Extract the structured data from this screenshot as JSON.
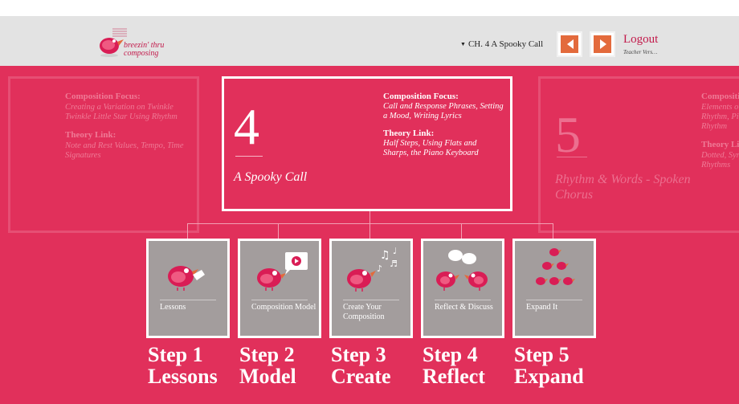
{
  "header": {
    "logo_line1": "breezin' thru",
    "logo_line2": "composing",
    "chapter_select": "CH. 4 A Spooky Call",
    "logout": "Logout",
    "teacher": "Teacher Vers…"
  },
  "colors": {
    "accent": "#e1305b",
    "header_bg": "#e3e3e3",
    "nav_orange": "#e36a3c",
    "step_gray": "#a39d9d"
  },
  "prev_chapter": {
    "focus_heading": "Composition Focus:",
    "focus_text": "Creating a Variation on Twinkle Twinkle Little Star Using Rhythm",
    "theory_heading": "Theory Link:",
    "theory_text": "Note and Rest Values, Tempo, Time Signatures"
  },
  "current_chapter": {
    "number": "4",
    "title": "A Spooky Call",
    "focus_heading": "Composition Focus:",
    "focus_text": "Call and Response Phrases, Setting a Mood, Writing Lyrics",
    "theory_heading": "Theory Link:",
    "theory_text": "Half Steps, Using Flats and Sharps, the Piano Keyboard"
  },
  "next_chapter": {
    "number": "5",
    "title": "Rhythm & Words - Spoken Chorus",
    "focus_heading": "Compositi",
    "focus_text": "Elements o Rhythm, Pi Rhythm",
    "theory_heading": "Theory Li",
    "theory_text": "Dotted, Syr Rhythms"
  },
  "steps": [
    {
      "label": "Lessons",
      "step": "Step 1",
      "name": "Lessons"
    },
    {
      "label": "Composition Model",
      "step": "Step 2",
      "name": "Model"
    },
    {
      "label": "Create Your Composition",
      "step": "Step 3",
      "name": "Create"
    },
    {
      "label": "Reflect & Discuss",
      "step": "Step 4",
      "name": "Reflect"
    },
    {
      "label": "Expand It",
      "step": "Step 5",
      "name": "Expand"
    }
  ]
}
